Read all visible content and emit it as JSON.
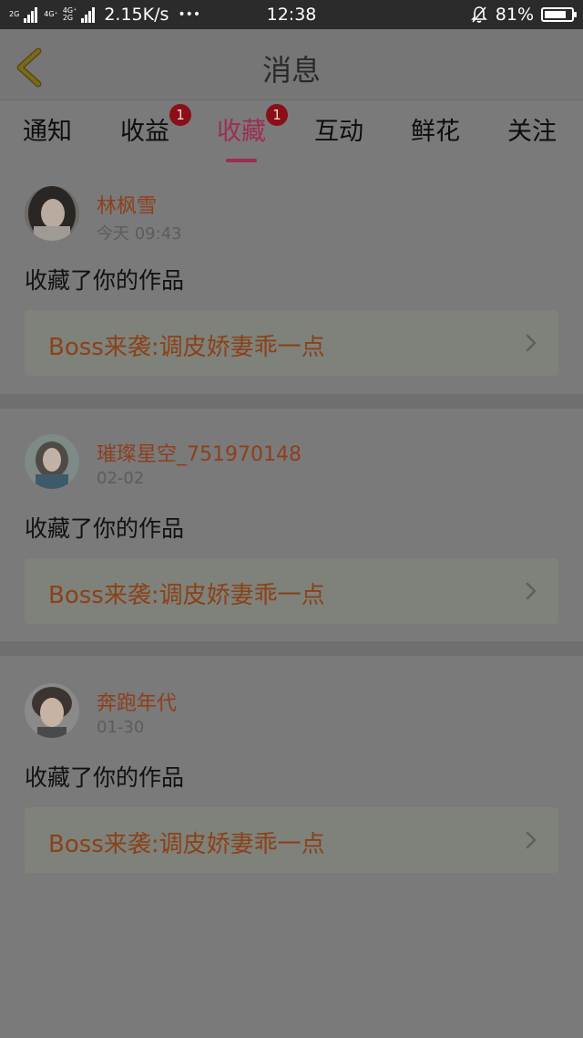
{
  "status_bar": {
    "net_top": "2G",
    "net_mid1": "4G⁺",
    "net_mid2": "4G⁺",
    "net_bottom": "2G",
    "speed": "2.15K/s",
    "more": "•••",
    "time": "12:38",
    "battery_percent": "81%",
    "battery_level": 0.81
  },
  "header": {
    "title": "消息"
  },
  "tabs": [
    {
      "label": "通知"
    },
    {
      "label": "收益",
      "badge": "1"
    },
    {
      "label": "收藏",
      "badge": "1",
      "active": true
    },
    {
      "label": "互动"
    },
    {
      "label": "鲜花"
    },
    {
      "label": "关注"
    }
  ],
  "messages": [
    {
      "user": "林枫雪",
      "time": "今天 09:43",
      "action": "收藏了你的作品",
      "work_title": "Boss来袭:调皮娇妻乖一点"
    },
    {
      "user": "璀璨星空_751970148",
      "time": "02-02",
      "action": "收藏了你的作品",
      "work_title": "Boss来袭:调皮娇妻乖一点"
    },
    {
      "user": "奔跑年代",
      "time": "01-30",
      "action": "收藏了你的作品",
      "work_title": "Boss来袭:调皮娇妻乖一点"
    }
  ],
  "colors": {
    "accent": "#9c2e52",
    "username": "#8e3f1c",
    "badge": "#8b0f17"
  }
}
